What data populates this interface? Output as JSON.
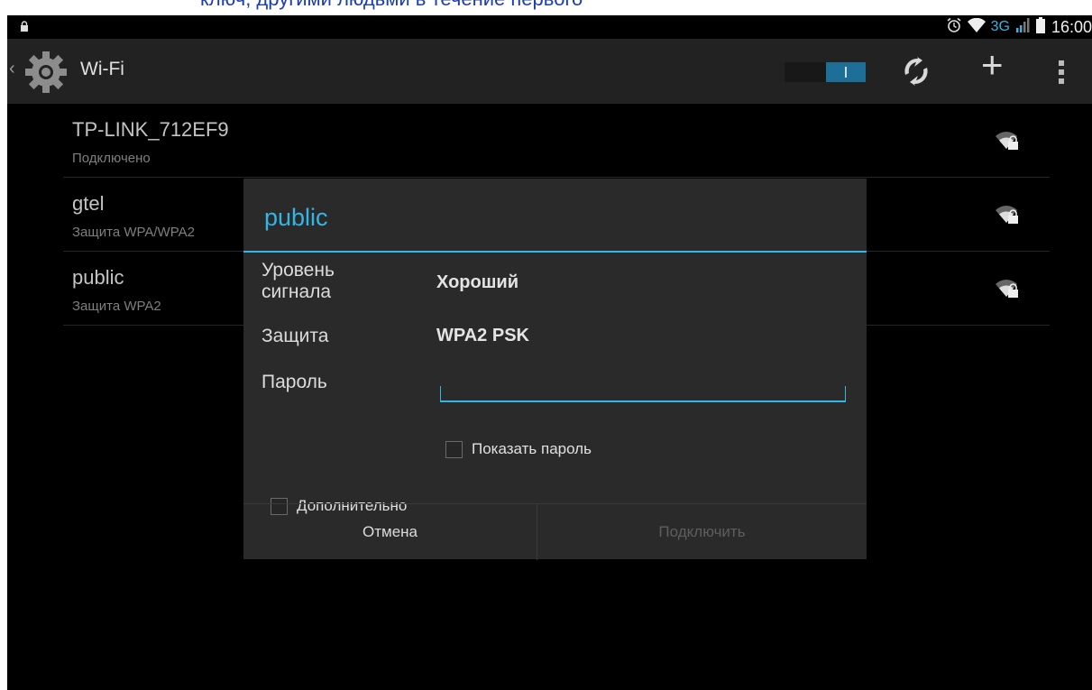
{
  "top_caption": "ключ, другими людьми в течение первого",
  "status_bar": {
    "lock_icon": "lock-icon",
    "network_type": "3G",
    "time": "16:00"
  },
  "action_bar": {
    "title": "Wi-Fi",
    "switch_state": "on",
    "icons": [
      "back-chevron-icon",
      "settings-gear-icon",
      "wps-icon",
      "add-icon",
      "overflow-menu-icon"
    ]
  },
  "networks": [
    {
      "ssid": "TP-LINK_712EF9",
      "status": "Подключено"
    },
    {
      "ssid": "gtel",
      "status": "Защита WPA/WPA2"
    },
    {
      "ssid": "public",
      "status": "Защита WPA2"
    }
  ],
  "dialog": {
    "title": "public",
    "signal_label": "Уровень сигнала",
    "signal_value": "Хороший",
    "security_label": "Защита",
    "security_value": "WPA2 PSK",
    "password_label": "Пароль",
    "password_value": "",
    "show_password_label": "Показать пароль",
    "advanced_label": "Дополнительно",
    "cancel_label": "Отмена",
    "connect_label": "Подключить"
  },
  "colors": {
    "accent": "#33b5e5",
    "background": "#000000",
    "dialog_bg": "#2a2a2a",
    "action_bar_bg": "#222222",
    "caption": "#1c3fb0"
  }
}
